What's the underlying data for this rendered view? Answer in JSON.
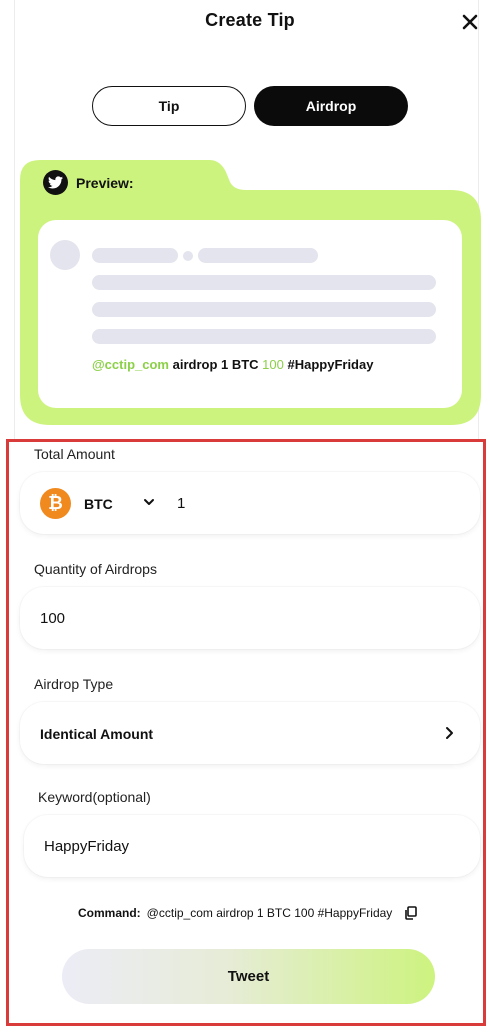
{
  "header": {
    "title": "Create Tip"
  },
  "tabs": [
    {
      "label": "Tip",
      "active": false
    },
    {
      "label": "Airdrop",
      "active": true
    }
  ],
  "preview": {
    "label": "Preview:",
    "tweet": {
      "mention": "@cctip_com",
      "text_mid": " airdrop 1 BTC ",
      "quantity": "100",
      "hashtag": " #HappyFriday"
    }
  },
  "form": {
    "total_amount": {
      "label": "Total Amount",
      "currency": "BTC",
      "value": "1"
    },
    "quantity": {
      "label": "Quantity of Airdrops",
      "value": "100"
    },
    "airdrop_type": {
      "label": "Airdrop Type",
      "value": "Identical Amount"
    },
    "keyword": {
      "label": "Keyword(optional)",
      "value": "HappyFriday"
    }
  },
  "command": {
    "label": "Command:",
    "value": "@cctip_com airdrop 1 BTC 100 #HappyFriday"
  },
  "actions": {
    "tweet_label": "Tweet"
  },
  "colors": {
    "accent_green": "#cdf37f",
    "btc_orange": "#f08a1f",
    "highlight_red": "#d93a3a"
  }
}
